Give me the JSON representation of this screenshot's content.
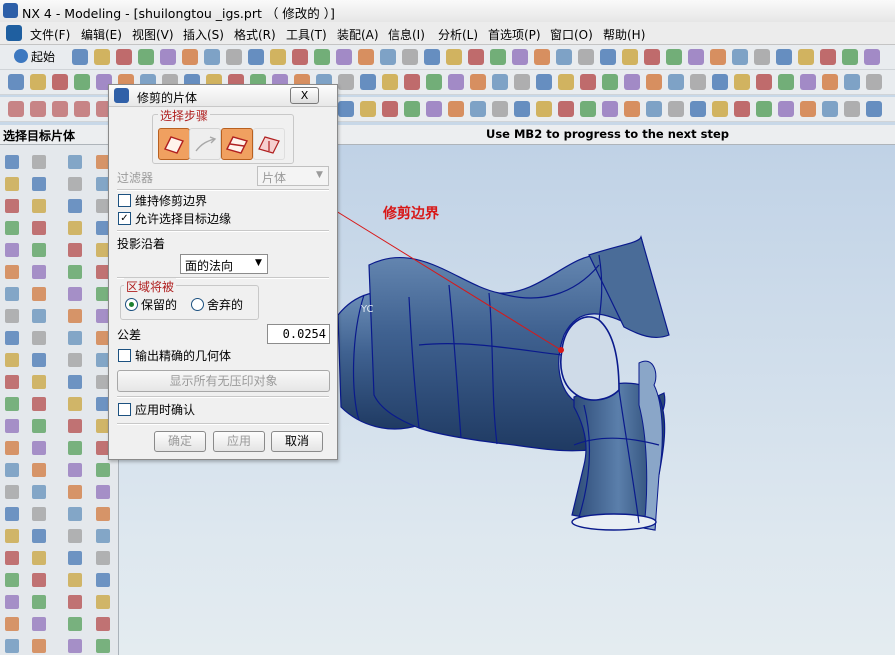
{
  "window": {
    "title": "NX 4 - Modeling - [shuilongtou _igs.prt （ 修改的 ）]"
  },
  "menubar": {
    "items": [
      "文件(F)",
      "编辑(E)",
      "视图(V)",
      "插入(S)",
      "格式(R)",
      "工具(T)",
      "装配(A)",
      "信息(I)",
      "分析(L)",
      "首选项(P)",
      "窗口(O)",
      "帮助(H)"
    ]
  },
  "toolbar": {
    "start_label": "起始"
  },
  "cue_line": "选择目标片体",
  "status_line": "Use MB2 to progress to the next step",
  "annotation": {
    "label": "修剪边界",
    "color": "#d81818"
  },
  "dialog": {
    "title": "修剪的片体",
    "close_label": "X",
    "steps_legend": "选择步骤",
    "filter_label": "过滤器",
    "filter_value": "片体",
    "keep_trim_boundary": "维持修剪边界",
    "allow_target_edges": "允许选择目标边缘",
    "project_along_label": "投影沿着",
    "project_along_value": "面的法向",
    "region_legend": "区域将被",
    "keep_option": "保留的",
    "discard_option": "舍弃的",
    "tolerance_label": "公差",
    "tolerance_value": "0.0254",
    "output_exact": "输出精确的几何体",
    "show_unstitched": "显示所有无压印对象",
    "confirm_on_apply": "应用时确认",
    "ok": "确定",
    "apply": "应用",
    "cancel": "取消"
  }
}
